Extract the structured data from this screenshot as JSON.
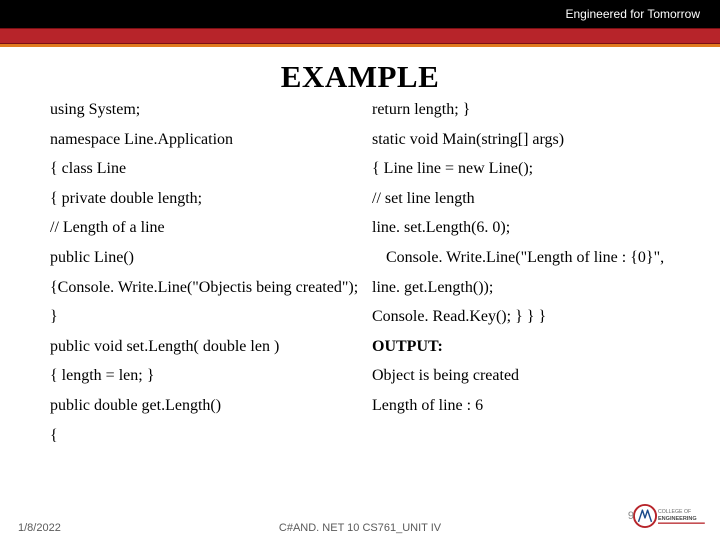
{
  "header": {
    "tagline": "Engineered for Tomorrow"
  },
  "title": "EXAMPLE",
  "left": {
    "l1": "using System;",
    "l2": "namespace Line.Application",
    "l3": "{  class Line",
    "l4": "{  private double length;",
    "l5": "// Length of a line",
    "l6": "public Line()",
    "l7": "{Console. Write.Line(\"Objectis being created\");",
    "l8": "}",
    "l9": "public void set.Length( double len )",
    "l10": " {  length = len; }",
    "l11": "public double get.Length()",
    "l12": " {"
  },
  "right": {
    "r1": " return length; }",
    "r2": "static void Main(string[] args)",
    "r3": "{   Line line = new Line();",
    "r4": "// set line length",
    "r5": "line. set.Length(6. 0);",
    "r6a": "Console. Write.Line(\"Length of line : {0}\",",
    "r7": "line. get.Length());",
    "r8": " Console. Read.Key(); } } }",
    "r9": "OUTPUT:",
    "r10": "Object is being created",
    "r11": " Length of line : 6"
  },
  "footer": {
    "date": "1/8/2022",
    "center": "C#AND. NET 10 CS761_UNIT IV",
    "page": "9",
    "logo_text_top": "COLLEGE OF",
    "logo_text_bottom": "ENGINEERING",
    "logo_mark": "MVJ"
  }
}
